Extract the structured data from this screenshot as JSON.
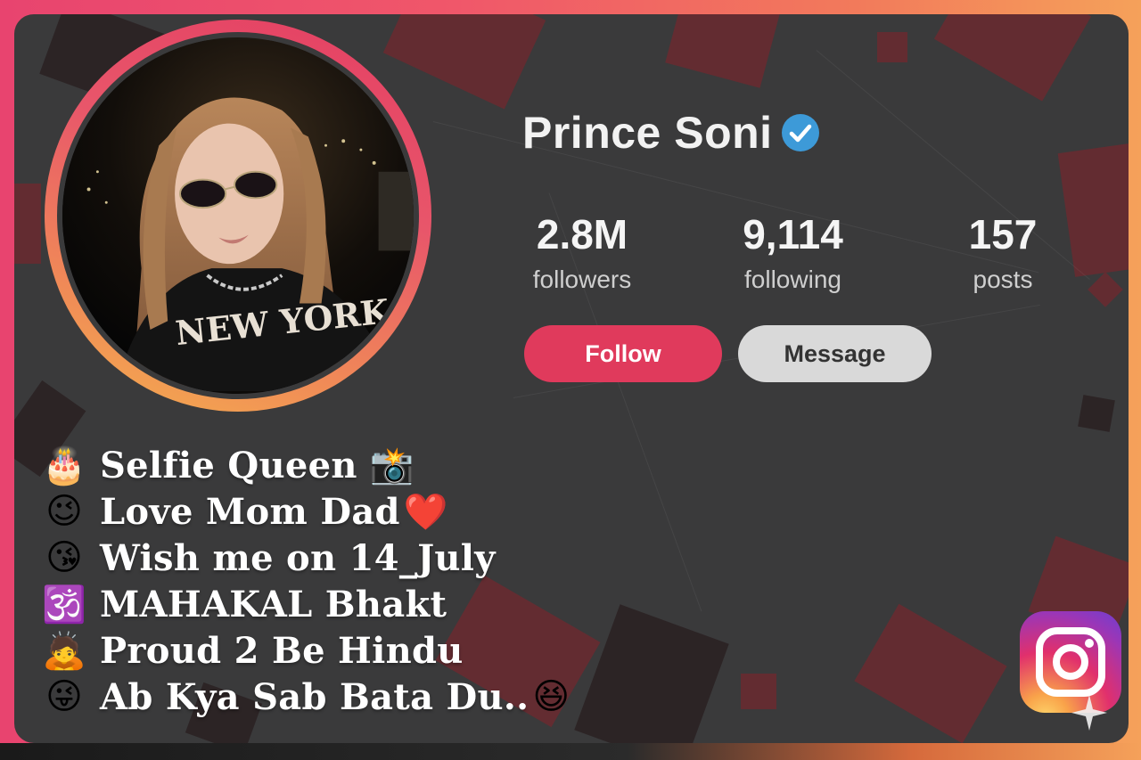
{
  "profile": {
    "name": "Prince Soni",
    "verified": true
  },
  "stats": [
    {
      "value": "2.8M",
      "label": "followers"
    },
    {
      "value": "9,114",
      "label": "following"
    },
    {
      "value": "157",
      "label": "posts"
    }
  ],
  "actions": {
    "follow_label": "Follow",
    "message_label": "Message"
  },
  "bio": [
    {
      "emoji": "🎂",
      "text": "Selfie Queen",
      "tail": "📸"
    },
    {
      "emoji": "😉",
      "text": "Love Mom Dad",
      "tail": "❤️"
    },
    {
      "emoji": "😘",
      "text": "Wish me on 14_July",
      "tail": ""
    },
    {
      "emoji": "🕉️",
      "text": "MAHAKAL Bhakt",
      "tail": ""
    },
    {
      "emoji": "🙇",
      "text": "Proud 2 Be Hindu",
      "tail": ""
    },
    {
      "emoji": "😜",
      "text": "Ab Kya Sab Bata Du..",
      "tail": "😆"
    }
  ],
  "colors": {
    "follow": "#e03a5c",
    "message": "#d9d9d9",
    "verified": "#3d9ad8",
    "card": "#3a3a3b"
  },
  "icons": {
    "verified": "verified-badge-icon",
    "logo": "instagram-logo-icon"
  }
}
